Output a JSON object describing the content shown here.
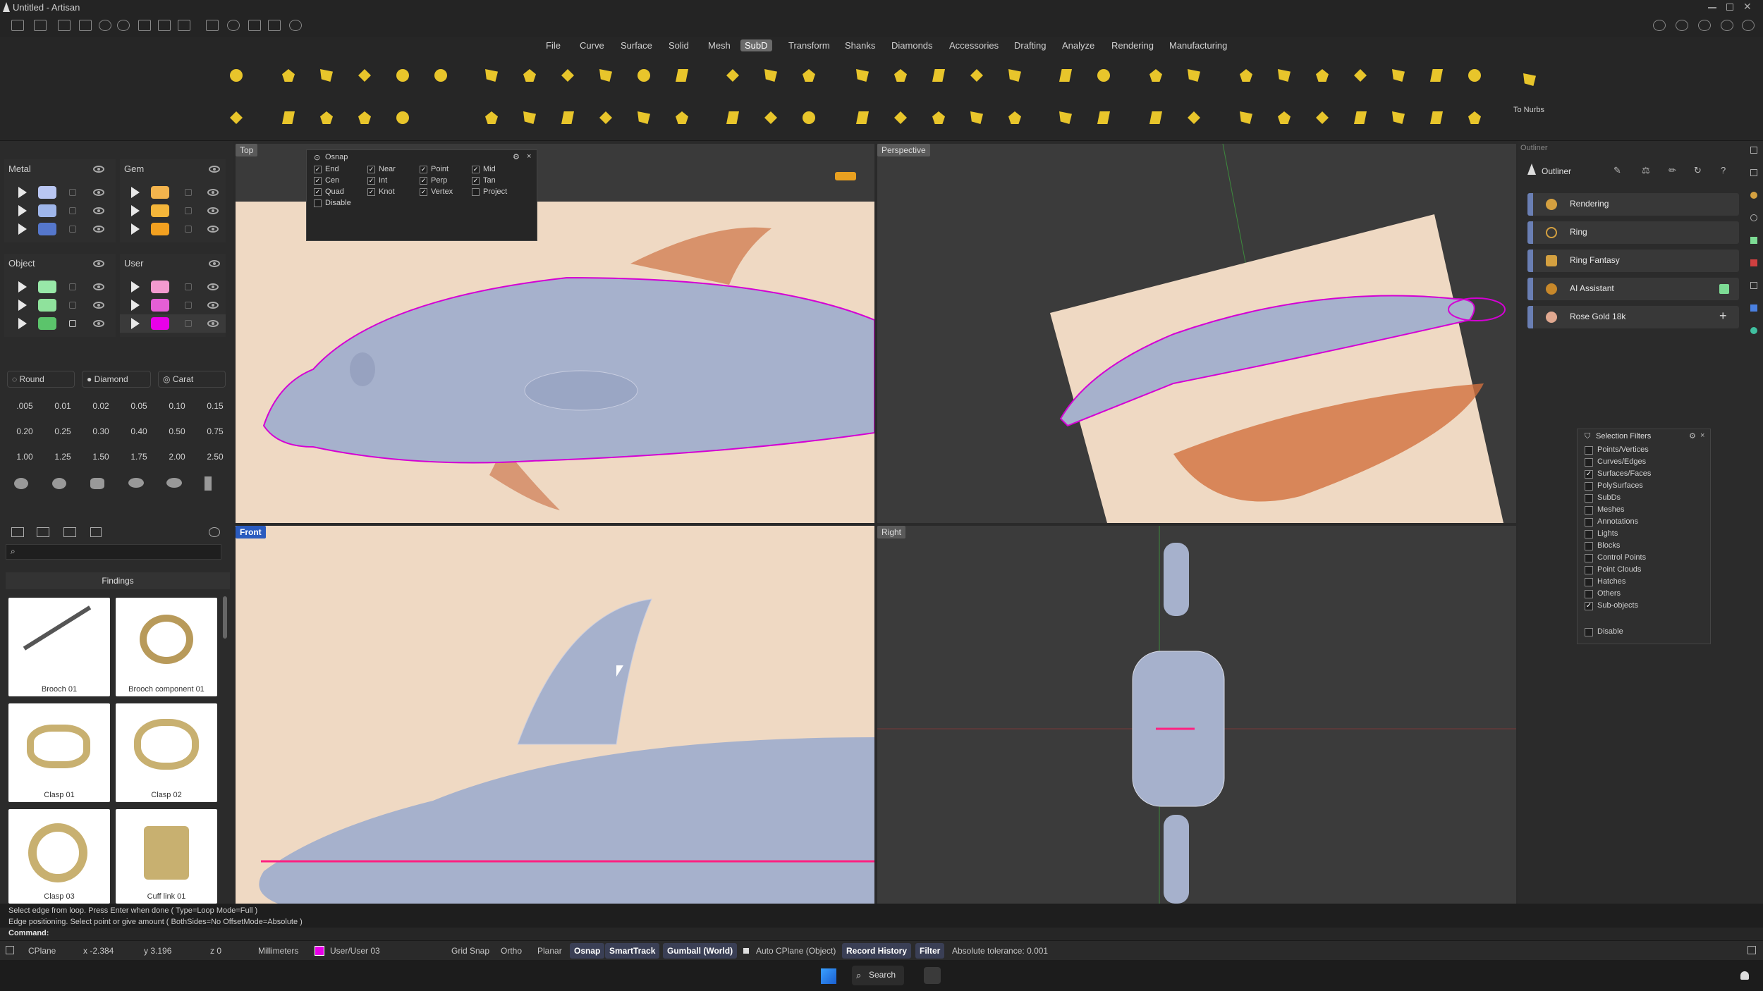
{
  "window": {
    "title": "Untitled - Artisan"
  },
  "menu": [
    "File",
    "Curve",
    "Surface",
    "Solid",
    "Mesh",
    "SubD",
    "Transform",
    "Shanks",
    "Diamonds",
    "Accessories",
    "Drafting",
    "Analyze",
    "Rendering",
    "Manufacturing"
  ],
  "menu_active": "SubD",
  "toolbar": {
    "to_nurbs_label": "To Nurbs"
  },
  "layers": {
    "metal": {
      "title": "Metal",
      "colors": [
        "#b9c6f2",
        "#9fb6ea",
        "#5577cc"
      ]
    },
    "gem": {
      "title": "Gem",
      "colors": [
        "#f3b44d",
        "#f5b63a",
        "#f2a020"
      ]
    },
    "object": {
      "title": "Object",
      "colors": [
        "#98e8a8",
        "#8fe29c",
        "#5bc46b"
      ]
    },
    "user": {
      "title": "User",
      "colors": [
        "#f29ad0",
        "#e45fd6",
        "#e800e8"
      ]
    }
  },
  "diamonds": {
    "buttons": [
      "Round",
      "Diamond",
      "Carat"
    ],
    "sizes": [
      ".005",
      "0.01",
      "0.02",
      "0.05",
      "0.10",
      "0.15",
      "0.20",
      "0.25",
      "0.30",
      "0.40",
      "0.50",
      "0.75",
      "1.00",
      "1.25",
      "1.50",
      "1.75",
      "2.00",
      "2.50"
    ]
  },
  "library": {
    "section": "Findings",
    "items": [
      "Brooch 01",
      "Brooch component 01",
      "Clasp 01",
      "Clasp 02",
      "Clasp 03",
      "Cuff link 01"
    ]
  },
  "osnap": {
    "title": "Osnap",
    "items": [
      {
        "label": "End",
        "checked": true
      },
      {
        "label": "Near",
        "checked": true
      },
      {
        "label": "Point",
        "checked": true
      },
      {
        "label": "Mid",
        "checked": true
      },
      {
        "label": "Cen",
        "checked": true
      },
      {
        "label": "Int",
        "checked": true
      },
      {
        "label": "Perp",
        "checked": true
      },
      {
        "label": "Tan",
        "checked": true
      },
      {
        "label": "Quad",
        "checked": true
      },
      {
        "label": "Knot",
        "checked": true
      },
      {
        "label": "Vertex",
        "checked": true
      },
      {
        "label": "Project",
        "checked": false
      },
      {
        "label": "Disable",
        "checked": false
      }
    ]
  },
  "viewports": {
    "top": "Top",
    "perspective": "Perspective",
    "front": "Front",
    "right": "Right"
  },
  "outliner": {
    "title": "Outliner",
    "header": "Outliner",
    "items": [
      "Rendering",
      "Ring",
      "Ring Fantasy",
      "AI Assistant",
      "Rose Gold 18k"
    ]
  },
  "selection_filters": {
    "title": "Selection Filters",
    "items": [
      {
        "label": "Points/Vertices",
        "checked": false
      },
      {
        "label": "Curves/Edges",
        "checked": false
      },
      {
        "label": "Surfaces/Faces",
        "checked": true
      },
      {
        "label": "PolySurfaces",
        "checked": false
      },
      {
        "label": "SubDs",
        "checked": false
      },
      {
        "label": "Meshes",
        "checked": false
      },
      {
        "label": "Annotations",
        "checked": false
      },
      {
        "label": "Lights",
        "checked": false
      },
      {
        "label": "Blocks",
        "checked": false
      },
      {
        "label": "Control Points",
        "checked": false
      },
      {
        "label": "Point Clouds",
        "checked": false
      },
      {
        "label": "Hatches",
        "checked": false
      },
      {
        "label": "Others",
        "checked": false
      },
      {
        "label": "Sub-objects",
        "checked": true
      }
    ],
    "disable": "Disable"
  },
  "command": {
    "history1": "Select edge from loop. Press Enter when done ( Type=Loop  Mode=Full )",
    "history2": "Edge positioning. Select point or give amount ( BothSides=No  OffsetMode=Absolute )",
    "prompt": "Command:"
  },
  "status": {
    "cplane": "CPlane",
    "x": "x -2.384",
    "y": "y 3.196",
    "z": "z 0",
    "units": "Millimeters",
    "layer": "User/User 03",
    "grid_snap": "Grid Snap",
    "ortho": "Ortho",
    "planar": "Planar",
    "osnap": "Osnap",
    "smarttrack": "SmartTrack",
    "gumball": "Gumball (World)",
    "auto_cplane": "Auto CPlane (Object)",
    "record_history": "Record History",
    "filter": "Filter",
    "tolerance": "Absolute tolerance: 0.001"
  },
  "taskbar": {
    "search": "Search"
  }
}
